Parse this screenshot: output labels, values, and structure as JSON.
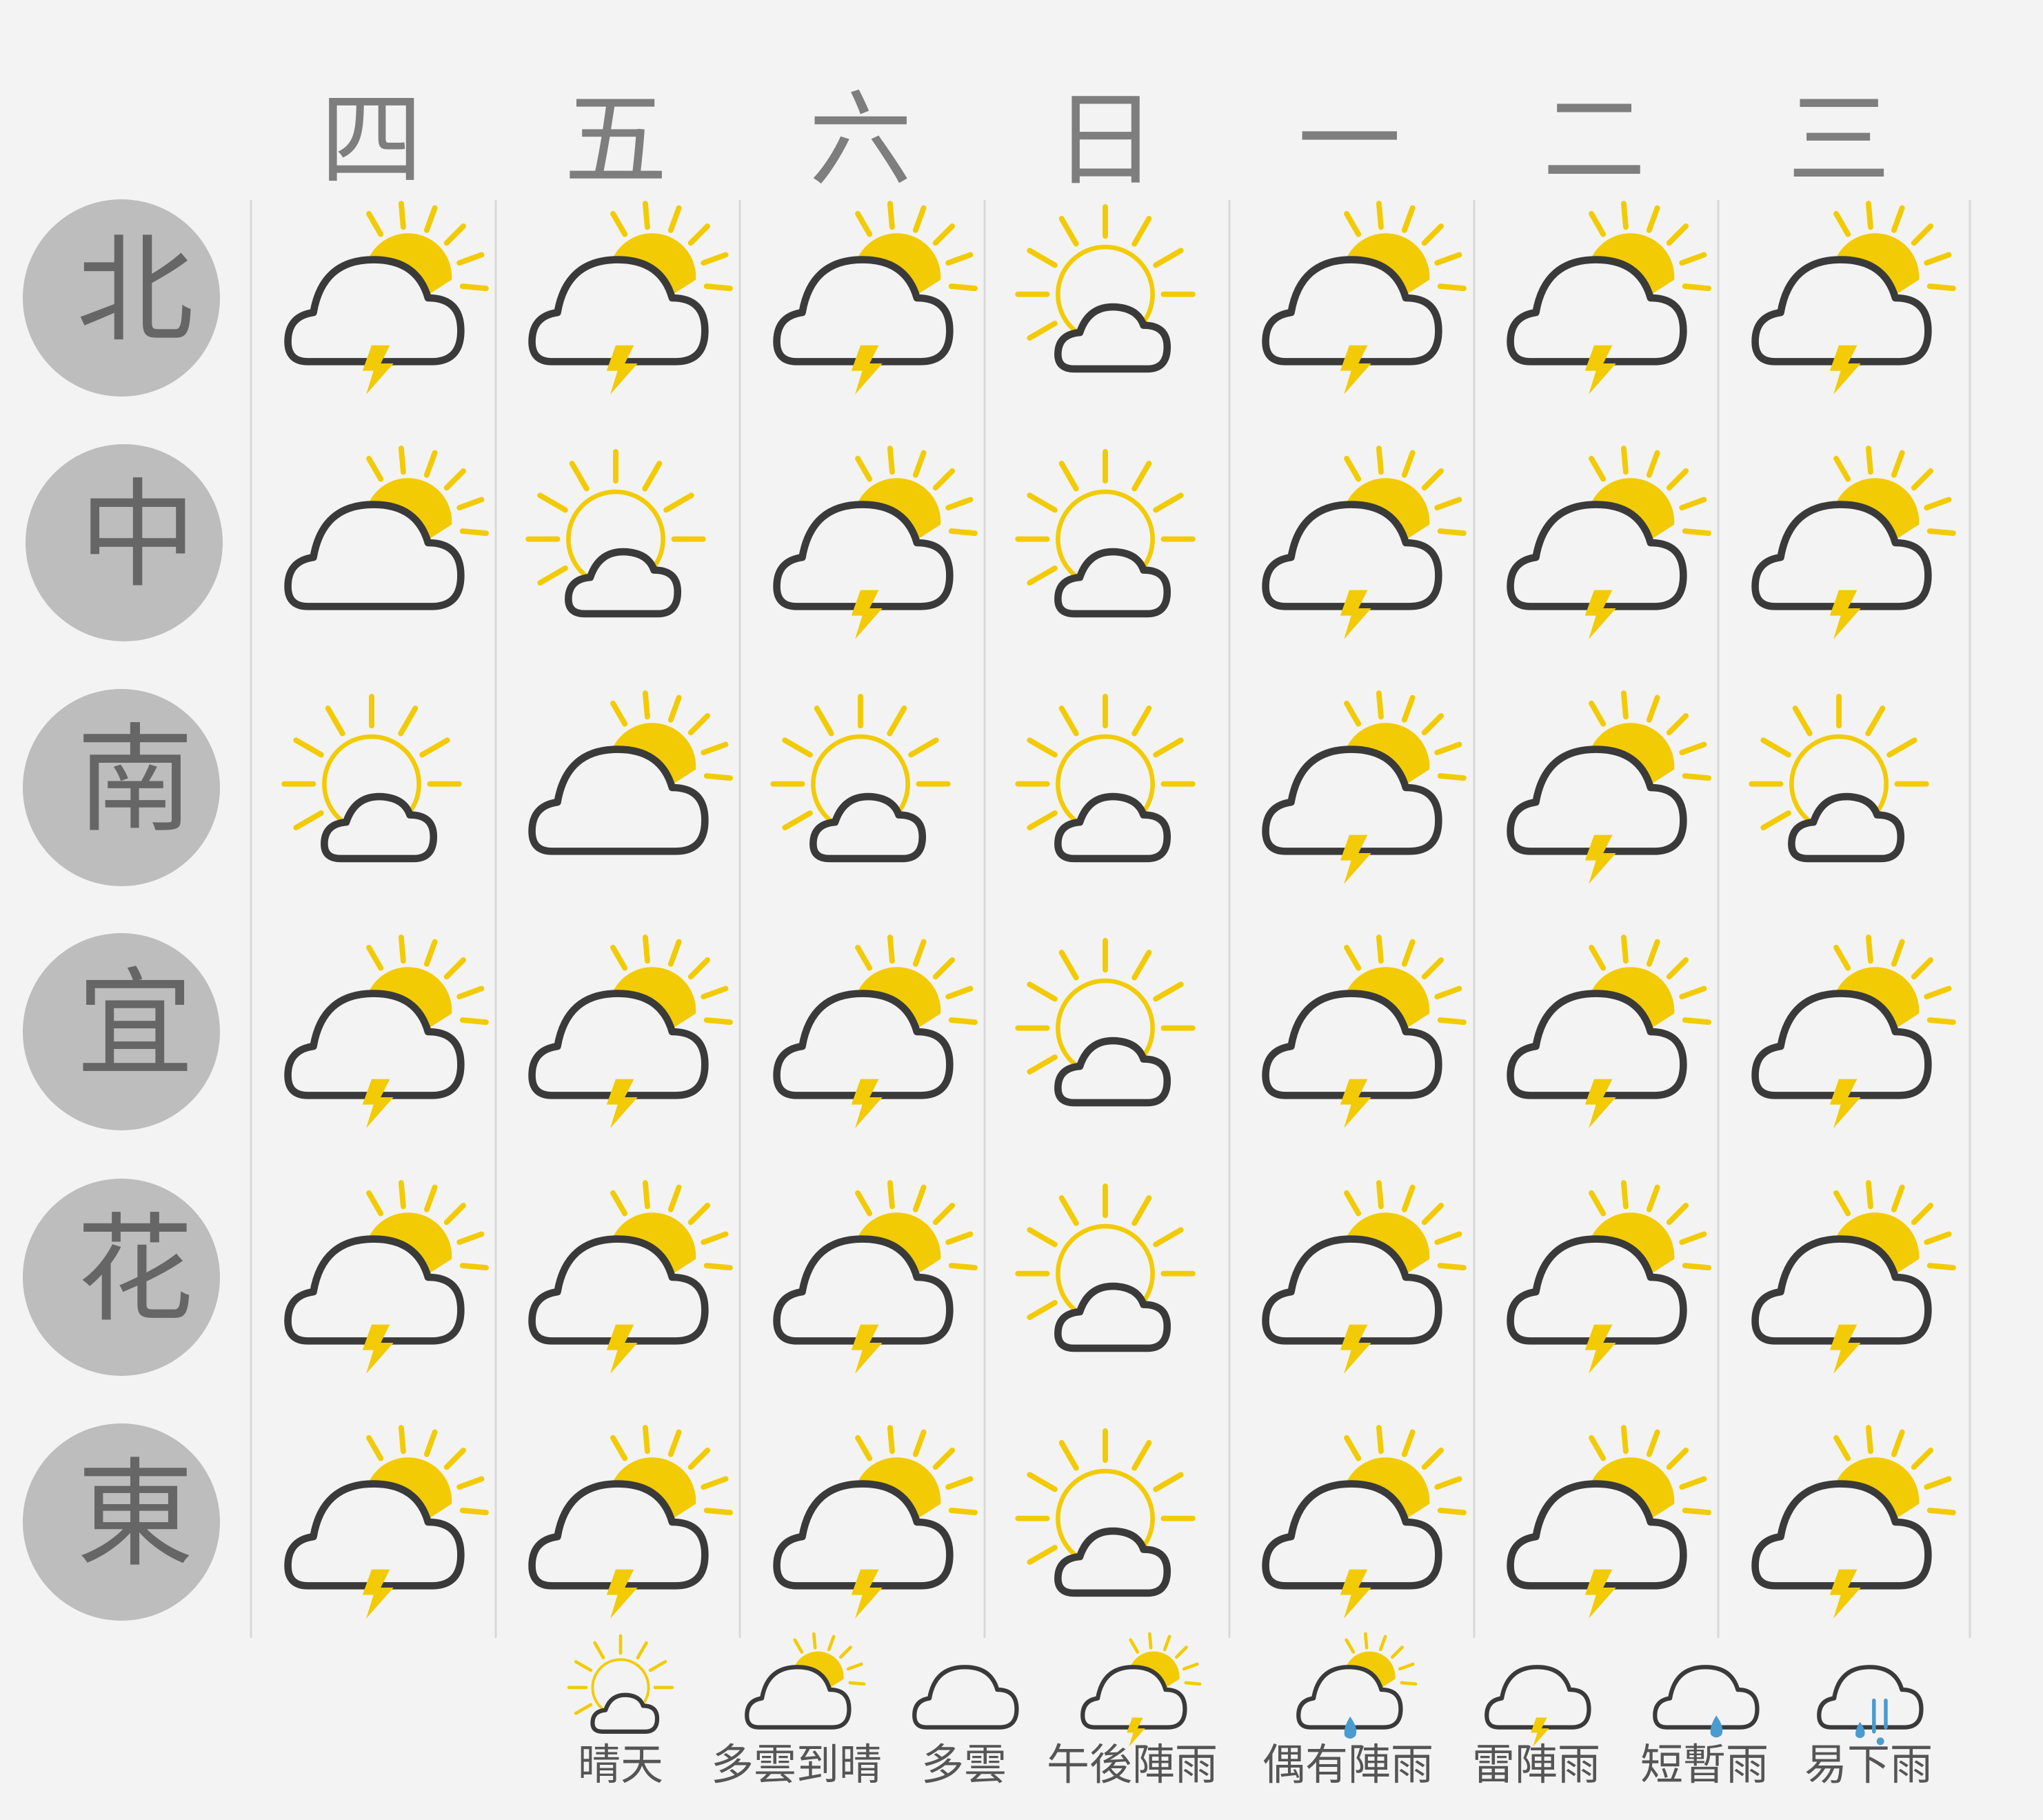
{
  "days": [
    "四",
    "五",
    "六",
    "日",
    "一",
    "二",
    "三"
  ],
  "regions": [
    "北",
    "中",
    "南",
    "宜",
    "花",
    "東"
  ],
  "forecast": [
    [
      "afternoon-storm",
      "afternoon-storm",
      "afternoon-storm",
      "sunny",
      "afternoon-storm",
      "afternoon-storm",
      "afternoon-storm"
    ],
    [
      "cloudy-to-sunny",
      "sunny",
      "afternoon-storm",
      "sunny",
      "afternoon-storm",
      "afternoon-storm",
      "afternoon-storm"
    ],
    [
      "sunny",
      "cloudy-to-sunny",
      "sunny",
      "sunny",
      "afternoon-storm",
      "afternoon-storm",
      "sunny"
    ],
    [
      "afternoon-storm",
      "afternoon-storm",
      "afternoon-storm",
      "sunny",
      "afternoon-storm",
      "afternoon-storm",
      "afternoon-storm"
    ],
    [
      "afternoon-storm",
      "afternoon-storm",
      "afternoon-storm",
      "sunny",
      "afternoon-storm",
      "afternoon-storm",
      "afternoon-storm"
    ],
    [
      "afternoon-storm",
      "afternoon-storm",
      "afternoon-storm",
      "sunny",
      "afternoon-storm",
      "afternoon-storm",
      "afternoon-storm"
    ]
  ],
  "legend": [
    {
      "icon": "sunny",
      "label": "晴天"
    },
    {
      "icon": "cloudy-to-sunny",
      "label": "多雲到晴"
    },
    {
      "icon": "cloudy",
      "label": "多雲"
    },
    {
      "icon": "afternoon-storm",
      "label": "午後陣雨"
    },
    {
      "icon": "occasional-shower",
      "label": "偶有陣雨"
    },
    {
      "icon": "thunder-shower",
      "label": "雷陣雨"
    },
    {
      "icon": "brief-rain",
      "label": "短暫雨"
    },
    {
      "icon": "easy-rain",
      "label": "易下雨"
    }
  ],
  "colors": {
    "background": "#f3f3f3",
    "day_text": "#7e7e7e",
    "region_circle": "#bdbdbd",
    "region_text": "#666666",
    "sun": "#f2cb05",
    "cloud_stroke": "#3a3a3a",
    "rain": "#4a9bd0",
    "grid_line": "#d8d8d8",
    "legend_text": "#555555"
  }
}
